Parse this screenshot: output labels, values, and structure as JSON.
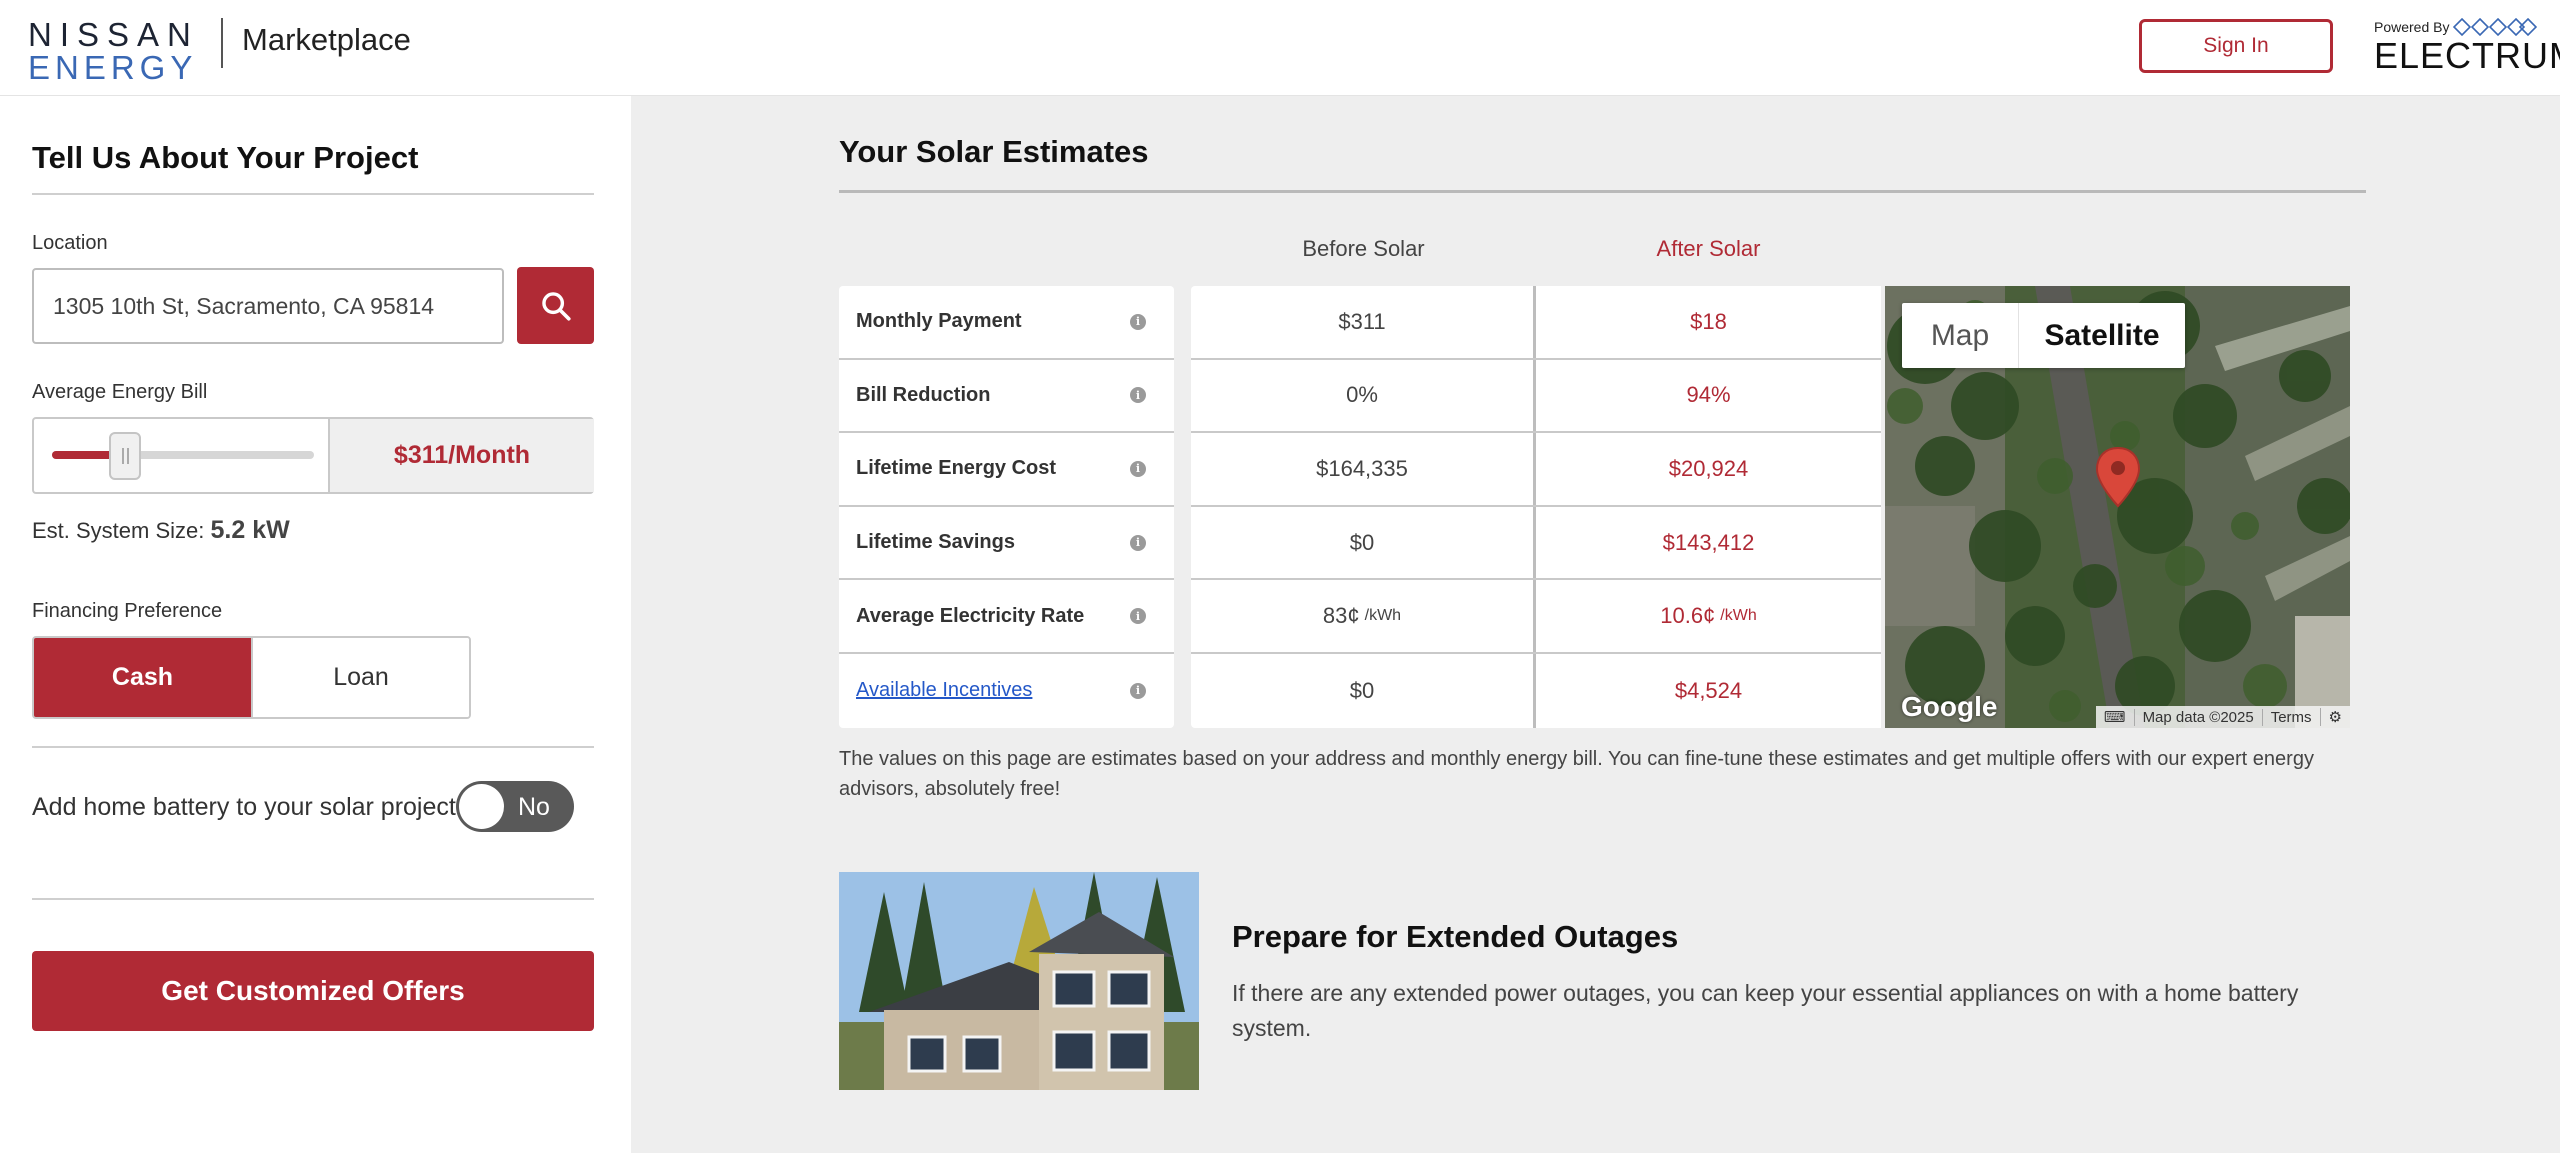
{
  "header": {
    "logo_line1": "NISSAN",
    "logo_line2": "ENERGY",
    "marketplace": "Marketplace",
    "sign_in": "Sign In",
    "powered_by": "Powered By",
    "electrum": "ELECTRUM"
  },
  "left": {
    "title": "Tell Us About Your Project",
    "location_label": "Location",
    "location_value": "1305 10th St, Sacramento, CA 95814",
    "bill_label": "Average Energy Bill",
    "bill_value": "$311/Month",
    "bill_slider_fraction": 0.28,
    "system_size_label": "Est. System Size:",
    "system_size_value": "5.2 kW",
    "financing_label": "Financing Preference",
    "financing_options": [
      "Cash",
      "Loan"
    ],
    "financing_selected": "Cash",
    "battery_question": "Add home battery to your solar project?",
    "battery_toggle": "No",
    "cta": "Get Customized Offers"
  },
  "estimates": {
    "title": "Your Solar Estimates",
    "col_before": "Before Solar",
    "col_after": "After Solar",
    "rows": [
      {
        "label": "Monthly Payment",
        "before": "$311",
        "after": "$18"
      },
      {
        "label": "Bill Reduction",
        "before": "0%",
        "after": "94%"
      },
      {
        "label": "Lifetime Energy Cost",
        "before": "$164,335",
        "after": "$20,924"
      },
      {
        "label": "Lifetime Savings",
        "before": "$0",
        "after": "$143,412"
      },
      {
        "label": "Average Electricity Rate",
        "before": "83¢",
        "before_unit": "/kWh",
        "after": "10.6¢",
        "after_unit": "/kWh"
      },
      {
        "label": "Available Incentives",
        "before": "$0",
        "after": "$4,524"
      }
    ],
    "info_glyph": "i",
    "disclaimer": "The values on this page are estimates based on your address and monthly energy bill. You can fine-tune these estimates and get multiple offers with our expert energy advisors, absolutely free!"
  },
  "map": {
    "tab_map": "Map",
    "tab_satellite": "Satellite",
    "google": "Google",
    "map_data": "Map data ©2025",
    "terms": "Terms"
  },
  "promo": {
    "title": "Prepare for Extended Outages",
    "text": "If there are any extended power outages, you can keep your essential appliances on with a home battery system."
  },
  "colors": {
    "brand_red": "#b02a35",
    "nissan_blue": "#3a68b4",
    "panel_gray": "#eeeeee"
  }
}
